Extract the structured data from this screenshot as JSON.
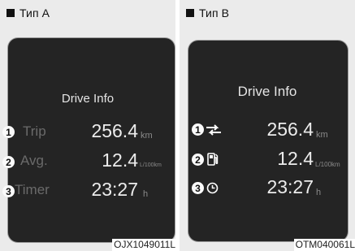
{
  "panel_a": {
    "type_label": "Тип A",
    "title": "Drive Info",
    "rows": [
      {
        "number": "1",
        "label": "Trip",
        "value": "256.4",
        "unit": "km"
      },
      {
        "number": "2",
        "label": "Avg.",
        "value": "12.4",
        "unit": "L/100km"
      },
      {
        "number": "3",
        "label": "Timer",
        "value": "23:27",
        "unit": "h"
      }
    ],
    "caption": "OJX1049011L"
  },
  "panel_b": {
    "type_label": "Тип B",
    "title": "Drive Info",
    "rows": [
      {
        "number": "1",
        "icon": "trip-arrows-icon",
        "value": "256.4",
        "unit": "km"
      },
      {
        "number": "2",
        "icon": "fuel-pump-icon",
        "value": "12.4",
        "unit": "L/100km"
      },
      {
        "number": "3",
        "icon": "clock-icon",
        "value": "23:27",
        "unit": "h"
      }
    ],
    "caption": "OTM040061L"
  }
}
